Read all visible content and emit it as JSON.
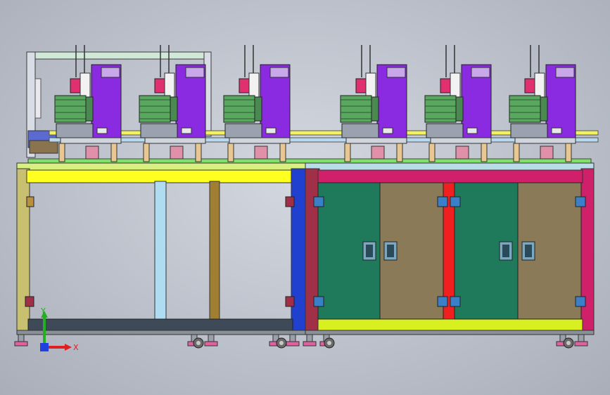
{
  "viewport": {
    "background_color": "#c2c7d0"
  },
  "triad": {
    "x_label": "X",
    "y_label": "Y",
    "x_color": "#e02020",
    "y_color": "#20b020",
    "z_color": "#2040e0"
  },
  "colors": {
    "station_purple": "#8a2be2",
    "table_yellow": "#ffff00",
    "door_green": "#1f7a5c",
    "door_brown": "#8a7a58",
    "frame_magenta": "#d0206a",
    "frame_blue": "#2040d0",
    "divider_red": "#f02020",
    "frame_olive": "#b0a050",
    "post_lightblue": "#a8d8f0",
    "post_bronze": "#9a7a30",
    "lime_rail": "#d8f020"
  }
}
